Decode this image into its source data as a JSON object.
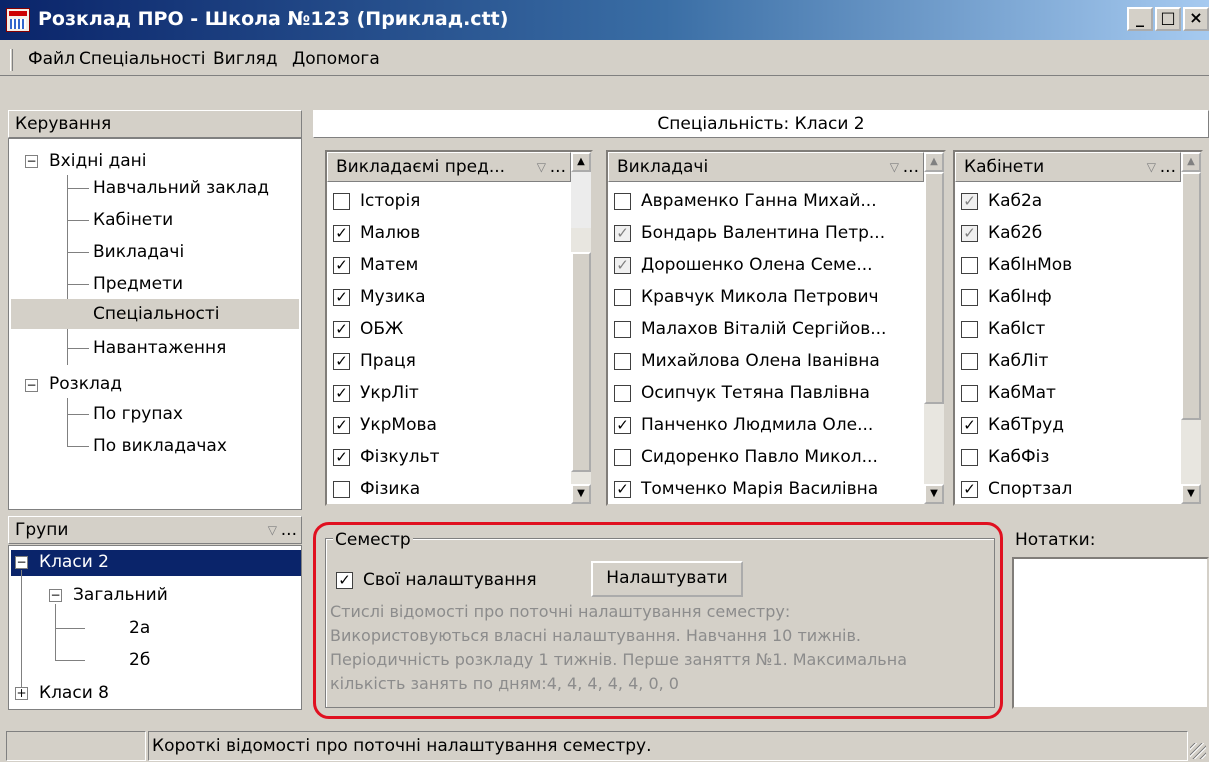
{
  "window": {
    "title": "Розклад ПРО - Школа №123 (Приклад.ctt)",
    "min": "_",
    "max": "□",
    "close": "×"
  },
  "menu": [
    "Файл",
    "Спеціальності",
    "Вигляд",
    "Допомога"
  ],
  "control_panel": {
    "title": "Керування",
    "tree": {
      "inputs": "Вхідні дані",
      "inputs_children": [
        "Навчальний заклад",
        "Кабінети",
        "Викладачі",
        "Предмети",
        "Спеціальності",
        "Навантаження"
      ],
      "schedule": "Розклад",
      "schedule_children": [
        "По групах",
        "По викладачах"
      ]
    }
  },
  "specialty_header": "Спеціальність: Класи 2",
  "subjects": {
    "title": "Викладаємі пред...",
    "dots": "...",
    "items": [
      {
        "label": "Історія",
        "state": "unchecked"
      },
      {
        "label": "Малюв",
        "state": "checked"
      },
      {
        "label": "Матем",
        "state": "checked"
      },
      {
        "label": "Музика",
        "state": "checked"
      },
      {
        "label": "ОБЖ",
        "state": "checked"
      },
      {
        "label": "Праця",
        "state": "checked"
      },
      {
        "label": "УкрЛіт",
        "state": "checked"
      },
      {
        "label": "УкрМова",
        "state": "checked"
      },
      {
        "label": "Фізкульт",
        "state": "checked"
      },
      {
        "label": "Фізика",
        "state": "unchecked"
      }
    ]
  },
  "teachers": {
    "title": "Викладачі",
    "dots": "...",
    "items": [
      {
        "label": "Авраменко Ганна Михай...",
        "state": "unchecked"
      },
      {
        "label": "Бондарь Валентина Петр...",
        "state": "grey"
      },
      {
        "label": "Дорошенко Олена Семе...",
        "state": "grey"
      },
      {
        "label": "Кравчук Микола Петрович",
        "state": "unchecked"
      },
      {
        "label": "Малахов Віталій Сергійов...",
        "state": "unchecked"
      },
      {
        "label": "Михайлова Олена Іванівна",
        "state": "unchecked"
      },
      {
        "label": "Осипчук Тетяна Павлівна",
        "state": "unchecked"
      },
      {
        "label": "Панченко Людмила Оле...",
        "state": "checked"
      },
      {
        "label": "Сидоренко Павло Микол...",
        "state": "unchecked"
      },
      {
        "label": "Томченко Марія Василівна",
        "state": "checked"
      }
    ]
  },
  "rooms": {
    "title": "Кабінети",
    "dots": "...",
    "items": [
      {
        "label": "Каб2а",
        "state": "grey"
      },
      {
        "label": "Каб2б",
        "state": "grey"
      },
      {
        "label": "КабІнМов",
        "state": "unchecked"
      },
      {
        "label": "КабІнф",
        "state": "unchecked"
      },
      {
        "label": "КабІст",
        "state": "unchecked"
      },
      {
        "label": "КабЛіт",
        "state": "unchecked"
      },
      {
        "label": "КабМат",
        "state": "unchecked"
      },
      {
        "label": "КабТруд",
        "state": "checked"
      },
      {
        "label": "КабФіз",
        "state": "unchecked"
      },
      {
        "label": "Спортзал",
        "state": "checked"
      }
    ]
  },
  "groups": {
    "title": "Групи",
    "dots": "...",
    "tree": {
      "root1": "Класи 2",
      "child": "Загальний",
      "leaves": [
        "2а",
        "2б"
      ],
      "root2": "Класи 8"
    }
  },
  "semester": {
    "legend": "Семестр",
    "own_settings_label": "Свої налаштування",
    "own_settings_checked": true,
    "configure_button": "Налаштувати",
    "info_lines": [
      "Стислі відомості про поточні налаштування семестру:",
      "Використовуються власні налаштування. Навчання 10 тижнів.",
      "Періодичність розкладу 1 тижнів. Перше заняття №1. Максимальна",
      "кількість занять по дням:4, 4, 4, 4, 4, 0, 0"
    ]
  },
  "notes": {
    "label": "Нотатки:"
  },
  "statusbar": {
    "text": "Короткі відомості про поточні налаштування семестру."
  }
}
